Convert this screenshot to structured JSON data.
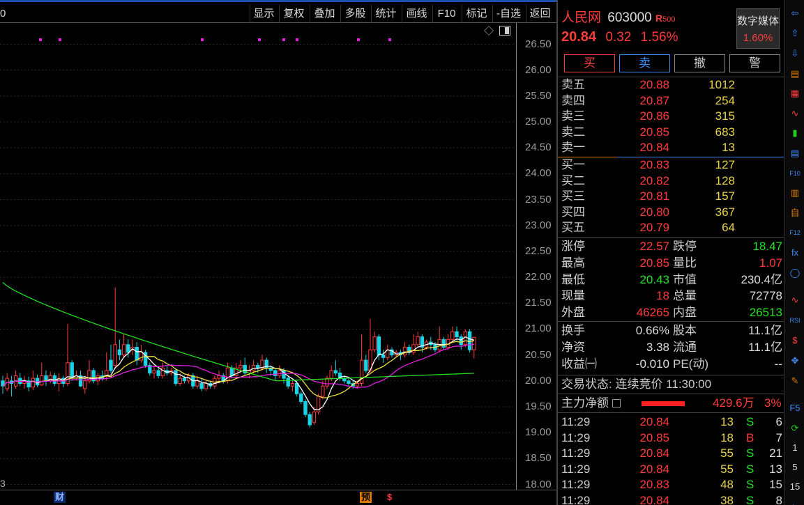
{
  "toolbar": {
    "items": [
      "显示",
      "复权",
      "叠加",
      "多股",
      "统计",
      "画线",
      "F10",
      "标记",
      "-自选",
      "返回"
    ],
    "corner": "0"
  },
  "stock": {
    "name": "人民网",
    "code": "603000",
    "tag": "R",
    "tag_num": "500",
    "price": "20.84",
    "change": "0.32",
    "change_pct": "1.56%",
    "sector_name": "数字媒体",
    "sector_pct": "1.60%"
  },
  "buttons": {
    "buy": "买",
    "sell": "卖",
    "cancel": "撤",
    "alert": "警"
  },
  "asks": [
    {
      "label": "卖五",
      "price": "20.88",
      "vol": "1012"
    },
    {
      "label": "卖四",
      "price": "20.87",
      "vol": "254"
    },
    {
      "label": "卖三",
      "price": "20.86",
      "vol": "315"
    },
    {
      "label": "卖二",
      "price": "20.85",
      "vol": "683"
    },
    {
      "label": "卖一",
      "price": "20.84",
      "vol": "13"
    }
  ],
  "bids": [
    {
      "label": "买一",
      "price": "20.83",
      "vol": "127"
    },
    {
      "label": "买二",
      "price": "20.82",
      "vol": "128"
    },
    {
      "label": "买三",
      "price": "20.81",
      "vol": "157"
    },
    {
      "label": "买四",
      "price": "20.80",
      "vol": "367"
    },
    {
      "label": "买五",
      "price": "20.79",
      "vol": "64"
    }
  ],
  "stats": [
    {
      "l1": "涨停",
      "v1": "22.57",
      "c1": "red",
      "l2": "跌停",
      "v2": "18.47",
      "c2": "green"
    },
    {
      "l1": "最高",
      "v1": "20.85",
      "c1": "red",
      "l2": "量比",
      "v2": "1.07",
      "c2": "red"
    },
    {
      "l1": "最低",
      "v1": "20.43",
      "c1": "green",
      "l2": "市值",
      "v2": "230.4亿",
      "c2": "white"
    },
    {
      "l1": "现量",
      "v1": "18",
      "c1": "red",
      "l2": "总量",
      "v2": "72778",
      "c2": "white"
    },
    {
      "l1": "外盘",
      "v1": "46265",
      "c1": "red",
      "l2": "内盘",
      "v2": "26513",
      "c2": "green"
    }
  ],
  "stats2": [
    {
      "l1": "换手",
      "v1": "0.66%",
      "l2": "股本",
      "v2": "11.1亿"
    },
    {
      "l1": "净资",
      "v1": "3.38",
      "l2": "流通",
      "v2": "11.1亿"
    },
    {
      "l1": "收益㈠",
      "v1": "-0.010",
      "l2": "PE(动)",
      "v2": "--"
    }
  ],
  "trade_status": "交易状态: 连续竞价 11:30:00",
  "main_flow": {
    "label": "主力净额",
    "value": "429.6万",
    "pct": "3%"
  },
  "ticks": [
    {
      "time": "11:29",
      "price": "20.84",
      "vol": "13",
      "side": "S",
      "n": "6"
    },
    {
      "time": "11:29",
      "price": "20.85",
      "vol": "18",
      "side": "B",
      "n": "7"
    },
    {
      "time": "11:29",
      "price": "20.84",
      "vol": "55",
      "side": "S",
      "n": "21"
    },
    {
      "time": "11:29",
      "price": "20.84",
      "vol": "55",
      "side": "S",
      "n": "13"
    },
    {
      "time": "11:29",
      "price": "20.83",
      "vol": "48",
      "side": "S",
      "n": "15"
    },
    {
      "time": "11:29",
      "price": "20.84",
      "vol": "38",
      "side": "S",
      "n": "8"
    }
  ],
  "chart_bottom": {
    "left_digit": "3",
    "m1": "财",
    "m2": "预",
    "m3": "$"
  },
  "sidebar": [
    "⇦",
    "⇧",
    "⇩",
    "▤",
    "▦",
    "∿",
    "▮",
    "▤",
    "F10",
    "▥",
    "自",
    "F12",
    "fx",
    "◯",
    "∿",
    "RSI",
    "$",
    "✥",
    "✎",
    "F5",
    "⟳",
    "1",
    "5",
    "15",
    "⇦"
  ],
  "colors": {
    "up": "#ff3b3b",
    "down": "#19d3e6",
    "ma5": "#ffffff",
    "ma10": "#f0e040",
    "ma20": "#e020e0",
    "ma60": "#22dd22"
  },
  "chart_data": {
    "type": "candlestick",
    "y_ticks": [
      26.5,
      26.0,
      25.5,
      25.0,
      24.5,
      24.0,
      23.5,
      23.0,
      22.5,
      22.0,
      21.5,
      21.0,
      20.5,
      20.0,
      19.5,
      19.0,
      18.5,
      18.0
    ],
    "ylim": [
      17.9,
      26.8
    ],
    "candles": [
      [
        20.0,
        19.9,
        20.1,
        19.75
      ],
      [
        19.85,
        20.05,
        20.15,
        19.8
      ],
      [
        20.0,
        19.95,
        20.1,
        19.7
      ],
      [
        19.9,
        20.1,
        20.2,
        19.85
      ],
      [
        20.05,
        19.95,
        20.15,
        19.9
      ],
      [
        19.95,
        20.0,
        20.1,
        19.85
      ],
      [
        20.0,
        19.88,
        20.08,
        19.8
      ],
      [
        19.88,
        20.05,
        20.2,
        19.82
      ],
      [
        20.05,
        19.92,
        20.12,
        19.88
      ],
      [
        19.92,
        20.1,
        20.35,
        19.9
      ],
      [
        20.1,
        20.0,
        20.2,
        19.9
      ],
      [
        20.0,
        20.1,
        20.18,
        19.95
      ],
      [
        20.1,
        19.95,
        20.15,
        19.9
      ],
      [
        19.95,
        20.05,
        20.15,
        19.8
      ],
      [
        20.05,
        19.95,
        20.1,
        19.88
      ],
      [
        19.95,
        20.35,
        21.1,
        19.9
      ],
      [
        20.35,
        20.05,
        20.4,
        20.0
      ],
      [
        20.05,
        20.1,
        20.2,
        20.0
      ],
      [
        20.1,
        19.9,
        20.2,
        19.88
      ],
      [
        19.85,
        20.0,
        20.1,
        19.75
      ],
      [
        20.0,
        20.2,
        20.4,
        19.95
      ],
      [
        20.2,
        20.0,
        20.25,
        19.95
      ],
      [
        20.0,
        20.1,
        20.15,
        19.92
      ],
      [
        20.1,
        20.05,
        20.2,
        20.0
      ],
      [
        20.1,
        20.2,
        20.55,
        20.0
      ],
      [
        20.4,
        20.2,
        20.7,
        20.15
      ],
      [
        20.3,
        20.7,
        21.8,
        20.25
      ],
      [
        20.6,
        20.5,
        20.8,
        20.4
      ],
      [
        20.5,
        20.7,
        20.9,
        20.45
      ],
      [
        20.7,
        20.55,
        20.8,
        20.45
      ],
      [
        20.6,
        20.65,
        20.8,
        20.5
      ],
      [
        20.65,
        20.4,
        20.75,
        20.3
      ],
      [
        20.4,
        20.55,
        20.7,
        20.35
      ],
      [
        20.55,
        20.3,
        20.6,
        20.25
      ],
      [
        20.3,
        20.15,
        20.35,
        20.1
      ],
      [
        20.15,
        20.2,
        20.3,
        20.05
      ],
      [
        20.2,
        20.1,
        20.25,
        20.05
      ],
      [
        20.1,
        20.25,
        20.35,
        20.05
      ],
      [
        20.2,
        20.15,
        20.3,
        20.1
      ],
      [
        20.15,
        20.2,
        20.25,
        20.1
      ],
      [
        20.2,
        19.95,
        20.25,
        19.9
      ],
      [
        19.95,
        20.05,
        20.15,
        19.9
      ],
      [
        20.05,
        20.0,
        20.1,
        19.95
      ],
      [
        20.0,
        20.1,
        20.15,
        19.95
      ],
      [
        20.1,
        19.9,
        20.15,
        19.85
      ],
      [
        19.9,
        20.0,
        20.1,
        19.85
      ],
      [
        19.95,
        19.85,
        20.05,
        19.8
      ],
      [
        19.85,
        19.95,
        20.0,
        19.8
      ],
      [
        19.95,
        19.9,
        20.0,
        19.85
      ],
      [
        19.9,
        20.05,
        20.1,
        19.85
      ],
      [
        20.05,
        20.1,
        20.2,
        19.95
      ],
      [
        20.1,
        20.0,
        20.15,
        19.95
      ],
      [
        20.0,
        20.25,
        20.35,
        19.95
      ],
      [
        20.25,
        20.1,
        20.3,
        20.05
      ],
      [
        20.1,
        20.25,
        20.35,
        20.05
      ],
      [
        20.25,
        20.3,
        20.4,
        20.15
      ],
      [
        20.3,
        20.15,
        20.45,
        20.1
      ],
      [
        20.15,
        20.2,
        20.3,
        20.05
      ],
      [
        20.2,
        20.3,
        20.4,
        20.15
      ],
      [
        20.3,
        20.25,
        20.35,
        20.15
      ],
      [
        20.25,
        20.4,
        20.5,
        20.2
      ],
      [
        20.4,
        20.25,
        20.45,
        20.15
      ],
      [
        20.25,
        20.2,
        20.3,
        20.1
      ],
      [
        20.2,
        20.1,
        20.25,
        20.0
      ],
      [
        20.1,
        20.2,
        20.3,
        20.05
      ],
      [
        20.2,
        20.05,
        20.25,
        19.95
      ],
      [
        20.05,
        19.9,
        20.1,
        19.85
      ],
      [
        19.9,
        19.95,
        20.0,
        19.8
      ],
      [
        19.95,
        19.75,
        20.0,
        19.7
      ],
      [
        19.75,
        19.6,
        19.8,
        19.55
      ],
      [
        19.6,
        19.35,
        19.65,
        19.3
      ],
      [
        19.35,
        19.15,
        19.4,
        19.1
      ],
      [
        19.2,
        19.4,
        19.5,
        19.15
      ],
      [
        19.4,
        19.7,
        19.75,
        19.35
      ],
      [
        19.7,
        19.9,
        20.0,
        19.65
      ],
      [
        19.9,
        20.05,
        20.1,
        19.85
      ],
      [
        20.05,
        20.2,
        20.3,
        20.0
      ],
      [
        20.2,
        20.15,
        20.4,
        20.1
      ],
      [
        20.15,
        20.05,
        20.25,
        20.0
      ],
      [
        20.05,
        20.0,
        20.1,
        19.95
      ],
      [
        20.0,
        19.95,
        20.05,
        19.9
      ],
      [
        19.95,
        19.9,
        20.0,
        19.85
      ],
      [
        19.9,
        19.95,
        20.0,
        19.85
      ],
      [
        19.95,
        20.4,
        20.9,
        19.9
      ],
      [
        20.4,
        20.2,
        20.5,
        20.15
      ],
      [
        20.2,
        20.6,
        21.2,
        20.15
      ],
      [
        20.6,
        20.85,
        20.95,
        20.55
      ],
      [
        20.85,
        20.5,
        20.9,
        20.4
      ],
      [
        20.5,
        20.45,
        20.6,
        20.35
      ],
      [
        20.45,
        20.6,
        20.7,
        20.4
      ],
      [
        20.6,
        20.5,
        20.65,
        20.45
      ],
      [
        20.5,
        20.55,
        20.6,
        20.45
      ],
      [
        20.55,
        20.5,
        20.6,
        20.4
      ],
      [
        20.5,
        20.65,
        20.75,
        20.45
      ],
      [
        20.65,
        20.55,
        20.7,
        20.5
      ],
      [
        20.55,
        20.7,
        20.9,
        20.5
      ],
      [
        20.7,
        20.85,
        20.95,
        20.65
      ],
      [
        20.85,
        20.65,
        20.9,
        20.55
      ],
      [
        20.65,
        20.75,
        20.8,
        20.6
      ],
      [
        20.75,
        20.7,
        20.85,
        20.6
      ],
      [
        20.7,
        20.6,
        20.75,
        20.55
      ],
      [
        20.6,
        20.8,
        21.05,
        20.55
      ],
      [
        20.8,
        20.65,
        20.85,
        20.6
      ],
      [
        20.65,
        20.8,
        20.9,
        20.6
      ],
      [
        20.8,
        20.95,
        21.05,
        20.75
      ],
      [
        20.95,
        20.85,
        21.05,
        20.75
      ],
      [
        20.85,
        20.7,
        20.9,
        20.6
      ],
      [
        20.7,
        20.95,
        21.0,
        20.65
      ],
      [
        20.95,
        20.6,
        21.0,
        20.55
      ],
      [
        20.6,
        20.84,
        20.85,
        20.43
      ]
    ]
  }
}
